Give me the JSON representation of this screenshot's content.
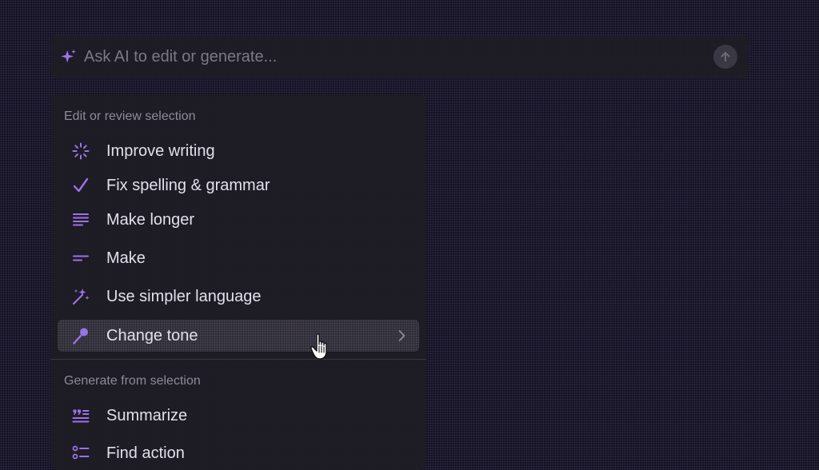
{
  "ask_bar": {
    "icon": "sparkle-icon",
    "placeholder": "Ask AI to edit or generate..."
  },
  "menu": {
    "edit_section": {
      "title": "Edit or review selection",
      "items": [
        {
          "label": "Improve writing",
          "icon": "sparkle-burst-icon"
        },
        {
          "label": "Fix spelling & grammar",
          "icon": "checkmark-icon"
        },
        {
          "label": "Make longer",
          "icon": "text-lines-icon"
        },
        {
          "label": "Make",
          "icon": "short-lines-icon"
        },
        {
          "label": "Use simpler language",
          "icon": "magic-wand-icon"
        },
        {
          "label": "Change tone",
          "icon": "microphone-icon",
          "has_submenu": true,
          "hovered": true
        }
      ]
    },
    "generate_section": {
      "title": "Generate from selection",
      "items": [
        {
          "label": "Summarize",
          "icon": "quote-list-icon"
        },
        {
          "label": "Find action",
          "icon": "checklist-icon"
        }
      ]
    }
  },
  "colors": {
    "accent": "#9a73e8",
    "background": "#12101c",
    "panel": "#1e1c24",
    "text": "#e2e0ea",
    "muted": "#8e8b98"
  }
}
